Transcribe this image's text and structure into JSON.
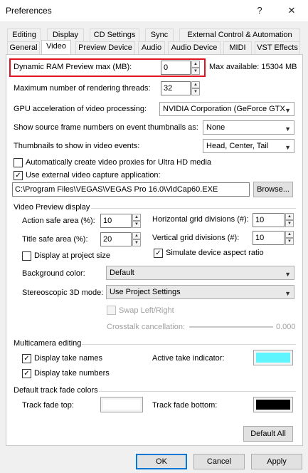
{
  "window": {
    "title": "Preferences",
    "help_icon": "?",
    "close_icon": "✕"
  },
  "tabs_row1": [
    "Editing",
    "Display",
    "CD Settings",
    "Sync",
    "External Control & Automation"
  ],
  "tabs_row2": [
    "General",
    "Video",
    "Preview Device",
    "Audio",
    "Audio Device",
    "MIDI",
    "VST Effects"
  ],
  "selected_tab": "Video",
  "ram_preview": {
    "label": "Dynamic RAM Preview max (MB):",
    "value": "0",
    "max_text": "Max available: 15304 MB"
  },
  "threads": {
    "label": "Maximum number of rendering threads:",
    "value": "32"
  },
  "gpu": {
    "label": "GPU acceleration of video processing:",
    "value": "NVIDIA Corporation (GeForce GTX"
  },
  "frame_numbers": {
    "label": "Show source frame numbers on event thumbnails as:",
    "value": "None"
  },
  "thumbnails": {
    "label": "Thumbnails to show in video events:",
    "value": "Head, Center, Tail"
  },
  "auto_proxies": {
    "label": "Automatically create video proxies for Ultra HD media",
    "checked": false
  },
  "external_capture": {
    "label": "Use external video capture application:",
    "checked": true,
    "path": "C:\\Program Files\\VEGAS\\VEGAS Pro 16.0\\VidCap60.EXE",
    "browse": "Browse..."
  },
  "video_preview": {
    "heading": "Video Preview display",
    "action_safe_label": "Action safe area (%):",
    "action_safe_value": "10",
    "title_safe_label": "Title safe area (%):",
    "title_safe_value": "20",
    "hgrid_label": "Horizontal grid divisions (#):",
    "hgrid_value": "10",
    "vgrid_label": "Vertical grid divisions (#):",
    "vgrid_value": "10",
    "display_project_size": {
      "label": "Display at project size",
      "checked": false
    },
    "simulate_aspect": {
      "label": "Simulate device aspect ratio",
      "checked": true
    },
    "bg_color_label": "Background color:",
    "bg_color_value": "Default",
    "stereo_label": "Stereoscopic 3D mode:",
    "stereo_value": "Use Project Settings",
    "swap_label": "Swap Left/Right",
    "crosstalk_label": "Crosstalk cancellation:",
    "crosstalk_value": "0.000"
  },
  "multicam": {
    "heading": "Multicamera editing",
    "take_names": {
      "label": "Display take names",
      "checked": true
    },
    "take_numbers": {
      "label": "Display take numbers",
      "checked": true
    },
    "active_take_label": "Active take indicator:",
    "active_take_color": "#5ff5ff"
  },
  "fades": {
    "heading": "Default track fade colors",
    "top_label": "Track fade top:",
    "top_color": "#ffffff",
    "bottom_label": "Track fade bottom:",
    "bottom_color": "#000000"
  },
  "buttons": {
    "default_all": "Default All",
    "ok": "OK",
    "cancel": "Cancel",
    "apply": "Apply"
  },
  "highlight_color": "#e0141e"
}
